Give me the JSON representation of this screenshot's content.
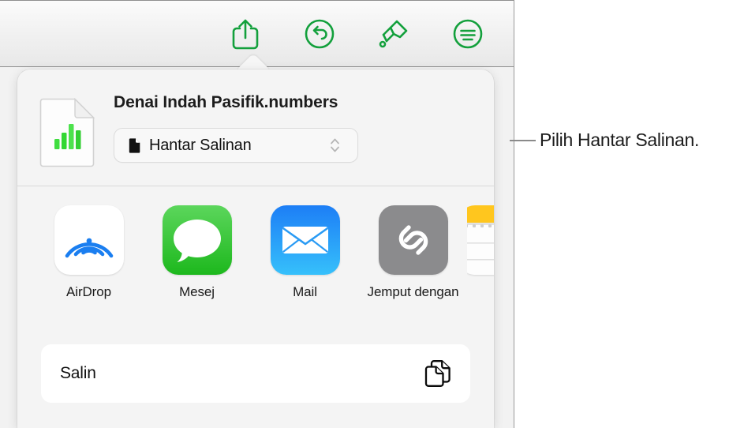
{
  "toolbar": {
    "buttons": [
      {
        "name": "share",
        "icon": "share-icon",
        "label": "Share"
      },
      {
        "name": "undo",
        "icon": "undo-icon",
        "label": "Undo"
      },
      {
        "name": "format",
        "icon": "paintbrush-icon",
        "label": "Format"
      },
      {
        "name": "more",
        "icon": "more-menu-icon",
        "label": "More"
      }
    ],
    "accent_color": "#13a03c"
  },
  "popover": {
    "document": {
      "icon": "numbers-document-icon",
      "title": "Denai Indah Pasifik.numbers"
    },
    "option_select": {
      "icon": "document-glyph-icon",
      "value": "Hantar Salinan",
      "chevron_icon": "chevron-up-down-icon"
    },
    "apps": [
      {
        "label": "AirDrop",
        "icon": "airdrop-icon"
      },
      {
        "label": "Mesej",
        "icon": "messages-icon"
      },
      {
        "label": "Mail",
        "icon": "mail-icon"
      },
      {
        "label": "Jemput dengan",
        "icon": "link-icon"
      },
      {
        "label": "",
        "icon": "notes-icon"
      }
    ],
    "actions": [
      {
        "label": "Salin",
        "icon": "copy-icon"
      }
    ]
  },
  "callout": {
    "text": "Pilih Hantar Salinan."
  }
}
